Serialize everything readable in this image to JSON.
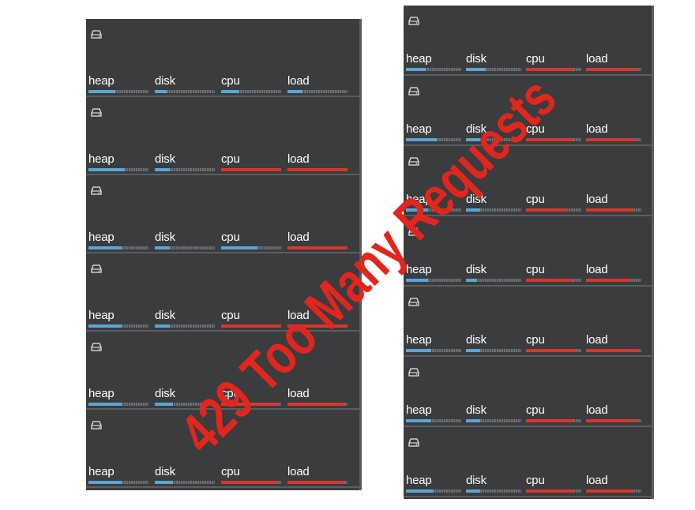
{
  "colors": {
    "panel_bg": "#3a3c3e",
    "bar_blue": "#5aa6d6",
    "bar_red": "#d8362e",
    "overlay_red": "#e3261d"
  },
  "overlay": {
    "text": "429 Too Many Requests"
  },
  "metric_labels": [
    "heap",
    "disk",
    "cpu",
    "load"
  ],
  "left_panel": {
    "nodes": [
      {
        "icon": "drive-icon",
        "bars": [
          {
            "fill": 0.45,
            "color": "blue"
          },
          {
            "fill": 0.2,
            "color": "blue"
          },
          {
            "fill": 0.3,
            "color": "blue"
          },
          {
            "fill": 0.25,
            "color": "blue"
          }
        ]
      },
      {
        "icon": "drive-icon",
        "bars": [
          {
            "fill": 0.6,
            "color": "blue"
          },
          {
            "fill": 0.25,
            "color": "blue"
          },
          {
            "fill": 1.0,
            "color": "red"
          },
          {
            "fill": 1.0,
            "color": "red"
          }
        ]
      },
      {
        "icon": "drive-icon",
        "bars": [
          {
            "fill": 0.55,
            "color": "blue"
          },
          {
            "fill": 0.25,
            "color": "blue"
          },
          {
            "fill": 0.6,
            "color": "blue"
          },
          {
            "fill": 1.0,
            "color": "red"
          }
        ]
      },
      {
        "icon": "drive-icon",
        "bars": [
          {
            "fill": 0.55,
            "color": "blue"
          },
          {
            "fill": 0.25,
            "color": "blue"
          },
          {
            "fill": 1.0,
            "color": "red"
          },
          {
            "fill": 1.0,
            "color": "red"
          }
        ]
      },
      {
        "icon": "drive-icon",
        "bars": [
          {
            "fill": 0.55,
            "color": "blue"
          },
          {
            "fill": 0.3,
            "color": "blue"
          },
          {
            "fill": 0.95,
            "color": "red"
          },
          {
            "fill": 0.95,
            "color": "red"
          }
        ]
      },
      {
        "icon": "drive-icon",
        "bars": [
          {
            "fill": 0.55,
            "color": "blue"
          },
          {
            "fill": 0.3,
            "color": "blue"
          },
          {
            "fill": 0.95,
            "color": "red"
          },
          {
            "fill": 0.95,
            "color": "red"
          }
        ]
      }
    ]
  },
  "right_panel": {
    "nodes": [
      {
        "icon": "drive-icon",
        "bars": [
          {
            "fill": 0.35,
            "color": "blue"
          },
          {
            "fill": 0.35,
            "color": "blue"
          },
          {
            "fill": 0.85,
            "color": "red"
          },
          {
            "fill": 0.9,
            "color": "red"
          }
        ]
      },
      {
        "icon": "drive-icon",
        "bars": [
          {
            "fill": 0.55,
            "color": "blue"
          },
          {
            "fill": 0.25,
            "color": "blue"
          },
          {
            "fill": 0.85,
            "color": "red"
          },
          {
            "fill": 0.9,
            "color": "red"
          }
        ]
      },
      {
        "icon": "drive-icon",
        "bars": [
          {
            "fill": 0.4,
            "color": "blue"
          },
          {
            "fill": 0.25,
            "color": "blue"
          },
          {
            "fill": 0.75,
            "color": "red"
          },
          {
            "fill": 0.85,
            "color": "red"
          }
        ]
      },
      {
        "icon": "drive-icon",
        "bars": [
          {
            "fill": 0.4,
            "color": "blue"
          },
          {
            "fill": 0.2,
            "color": "blue"
          },
          {
            "fill": 0.85,
            "color": "red"
          },
          {
            "fill": 0.8,
            "color": "red"
          }
        ]
      },
      {
        "icon": "drive-icon",
        "bars": [
          {
            "fill": 0.45,
            "color": "blue"
          },
          {
            "fill": 0.25,
            "color": "blue"
          },
          {
            "fill": 0.9,
            "color": "red"
          },
          {
            "fill": 0.95,
            "color": "red"
          }
        ]
      },
      {
        "icon": "drive-icon",
        "bars": [
          {
            "fill": 0.45,
            "color": "blue"
          },
          {
            "fill": 0.25,
            "color": "blue"
          },
          {
            "fill": 0.85,
            "color": "red"
          },
          {
            "fill": 0.9,
            "color": "red"
          }
        ]
      },
      {
        "icon": "drive-icon",
        "bars": [
          {
            "fill": 0.5,
            "color": "blue"
          },
          {
            "fill": 0.25,
            "color": "blue"
          },
          {
            "fill": 0.85,
            "color": "red"
          },
          {
            "fill": 0.85,
            "color": "red"
          }
        ]
      }
    ]
  }
}
